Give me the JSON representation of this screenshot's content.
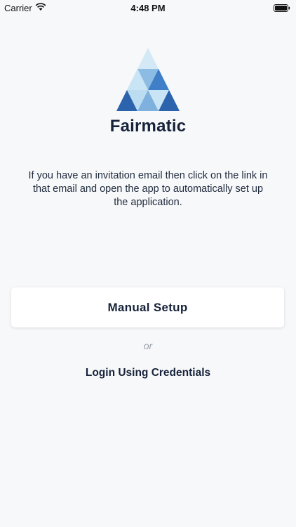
{
  "status_bar": {
    "carrier": "Carrier",
    "time": "4:48 PM",
    "icons": [
      "wifi-icon",
      "battery-icon"
    ]
  },
  "app": {
    "name": "Fairmatic",
    "logo_icon": "fairmatic-triangle-logo",
    "logo_colors": [
      "#2b63ad",
      "#4b8ad0",
      "#7fb1df",
      "#c9e4f4"
    ]
  },
  "onboarding": {
    "description": "If you have an invitation email then click on the link in that email and open the app to automatically set up the application.",
    "manual_setup_label": "Manual Setup",
    "or_label": "or",
    "login_label": "Login Using Credentials"
  }
}
